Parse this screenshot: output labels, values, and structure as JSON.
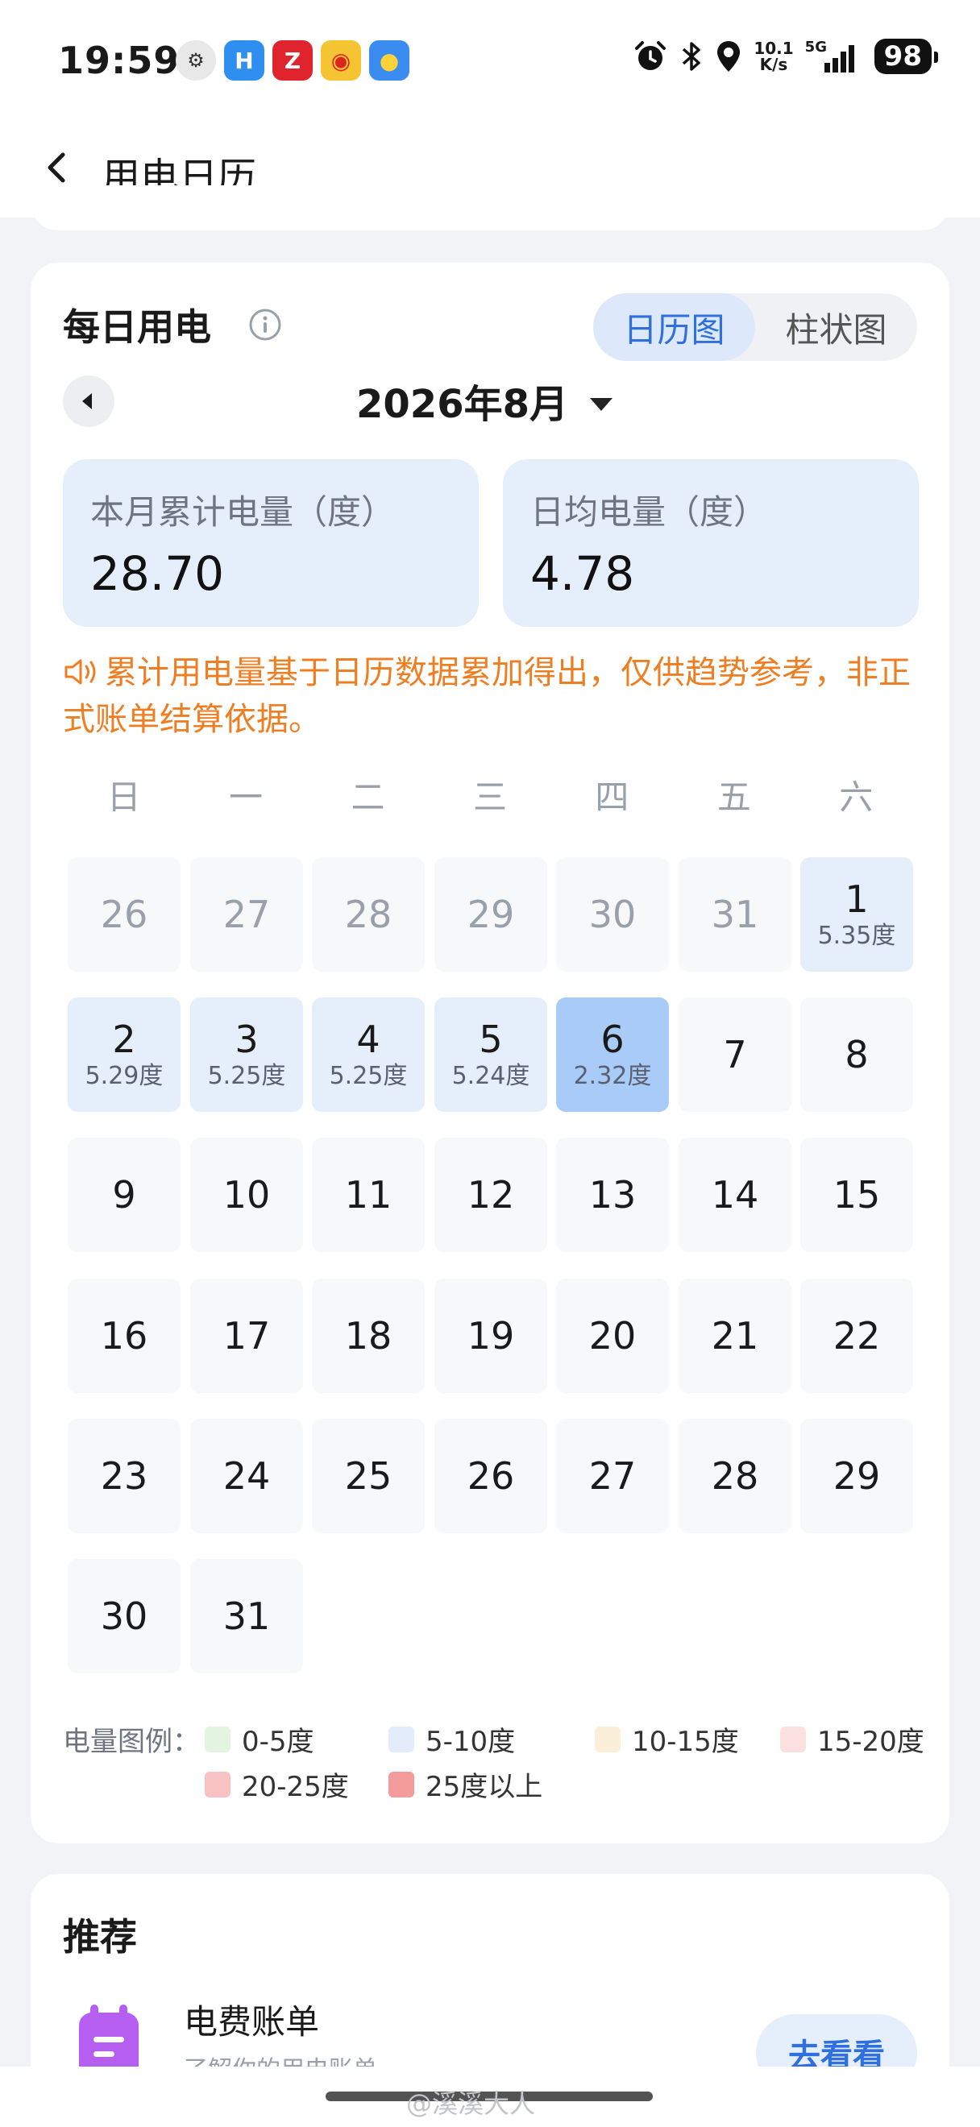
{
  "status_bar": {
    "time": "19:59",
    "net_speed_value": "10.1",
    "net_speed_unit": "K/s",
    "network": "5G",
    "battery": "98"
  },
  "header": {
    "title": "用电日历"
  },
  "daily": {
    "title": "每日用电",
    "tabs": [
      "日历图",
      "柱状图"
    ],
    "active_tab": "日历图",
    "month": "2026年8月",
    "stats": {
      "month_total_label": "本月累计电量（度）",
      "month_total_value": "28.70",
      "daily_avg_label": "日均电量（度）",
      "daily_avg_value": "4.78"
    },
    "notice": "累计用电量基于日历数据累加得出，仅供趋势参考，非正式账单结算依据。",
    "weekdays": [
      "日",
      "一",
      "二",
      "三",
      "四",
      "五",
      "六"
    ],
    "days": [
      {
        "n": "26",
        "other": true
      },
      {
        "n": "27",
        "other": true
      },
      {
        "n": "28",
        "other": true
      },
      {
        "n": "29",
        "other": true
      },
      {
        "n": "30",
        "other": true
      },
      {
        "n": "31",
        "other": true
      },
      {
        "n": "1",
        "use": "5.35度",
        "tier": 1
      },
      {
        "n": "2",
        "use": "5.29度",
        "tier": 1
      },
      {
        "n": "3",
        "use": "5.25度",
        "tier": 1
      },
      {
        "n": "4",
        "use": "5.25度",
        "tier": 1
      },
      {
        "n": "5",
        "use": "5.24度",
        "tier": 1
      },
      {
        "n": "6",
        "use": "2.32度",
        "today": true
      },
      {
        "n": "7"
      },
      {
        "n": "8"
      },
      {
        "n": "9"
      },
      {
        "n": "10"
      },
      {
        "n": "11"
      },
      {
        "n": "12"
      },
      {
        "n": "13"
      },
      {
        "n": "14"
      },
      {
        "n": "15"
      },
      {
        "n": "16"
      },
      {
        "n": "17"
      },
      {
        "n": "18"
      },
      {
        "n": "19"
      },
      {
        "n": "20"
      },
      {
        "n": "21"
      },
      {
        "n": "22"
      },
      {
        "n": "23"
      },
      {
        "n": "24"
      },
      {
        "n": "25"
      },
      {
        "n": "26"
      },
      {
        "n": "27"
      },
      {
        "n": "28"
      },
      {
        "n": "29"
      },
      {
        "n": "30"
      },
      {
        "n": "31"
      }
    ],
    "legend": {
      "title": "电量图例：",
      "items": [
        {
          "label": "0-5度",
          "color": "#e3f5e1"
        },
        {
          "label": "5-10度",
          "color": "#e2ecfb"
        },
        {
          "label": "10-15度",
          "color": "#fcefd9"
        },
        {
          "label": "15-20度",
          "color": "#fbe0e0"
        },
        {
          "label": "20-25度",
          "color": "#f9c2c2"
        },
        {
          "label": "25度以上",
          "color": "#f49b9b"
        }
      ]
    }
  },
  "recommend": {
    "title": "推荐",
    "item_title": "电费账单",
    "item_subtitle": "了解你的用电账单",
    "button": "去看看"
  },
  "watermark": "@溪溪大人"
}
